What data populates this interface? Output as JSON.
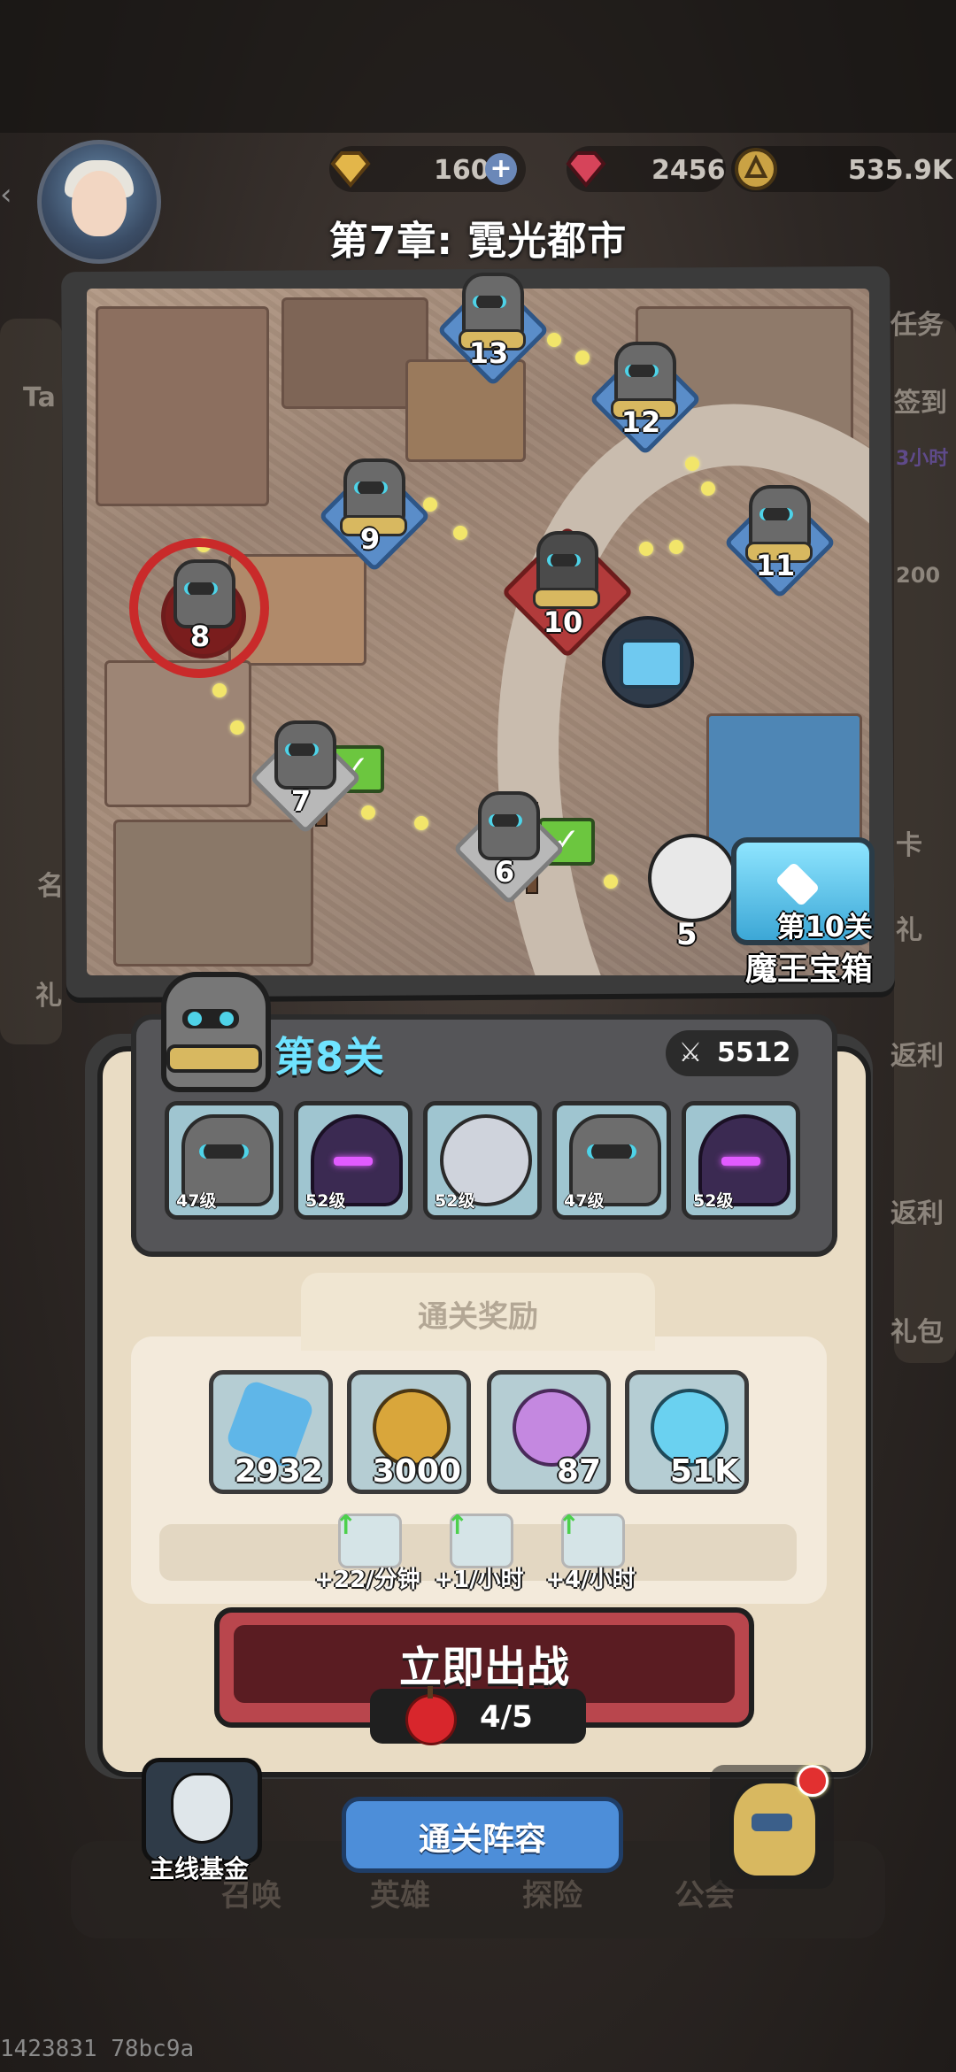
{
  "resources": {
    "gold_bars": "160",
    "gems": "2456",
    "coins": "535.9K"
  },
  "chapter": {
    "title": "第7章: 霓光都市"
  },
  "map": {
    "stages": [
      {
        "num": "13",
        "state": "locked"
      },
      {
        "num": "12",
        "state": "locked"
      },
      {
        "num": "9",
        "state": "locked"
      },
      {
        "num": "11",
        "state": "locked"
      },
      {
        "num": "10",
        "state": "boss"
      },
      {
        "num": "8",
        "state": "current"
      },
      {
        "num": "7",
        "state": "cleared"
      },
      {
        "num": "6",
        "state": "cleared"
      },
      {
        "num": "5",
        "state": "cleared"
      }
    ],
    "boss_chest": {
      "line1": "第10关",
      "line2": "魔王宝箱"
    },
    "check_mark": "✓"
  },
  "side_ghost_text": [
    "任务",
    "签到",
    "3小时",
    "200",
    "Ta",
    "名",
    "礼",
    "礼",
    "返利",
    "返利",
    "礼包",
    "卡"
  ],
  "stage_panel": {
    "stage_label": "第8关",
    "power": "5512",
    "enemies": [
      {
        "type": "robot",
        "level": "47级"
      },
      {
        "type": "mage",
        "level": "52级"
      },
      {
        "type": "pale",
        "level": "52级"
      },
      {
        "type": "robot",
        "level": "47级"
      },
      {
        "type": "mage",
        "level": "52级"
      }
    ],
    "reward_title": "通关奖励",
    "rewards": [
      {
        "item": "crystal",
        "qty": "2932",
        "color": "#5fb6e8"
      },
      {
        "item": "gold-coin",
        "qty": "3000",
        "color": "#d9a63b"
      },
      {
        "item": "purple-potion",
        "qty": "87",
        "color": "#c488e0"
      },
      {
        "item": "blue-potion",
        "qty": "51K",
        "color": "#6ad1f0"
      }
    ],
    "rates": [
      {
        "item": "blue-potion",
        "text": "+22/分钟"
      },
      {
        "item": "purple-potion",
        "text": "+1/小时"
      },
      {
        "item": "crystal",
        "text": "+4/小时"
      }
    ],
    "battle_button": "立即出战",
    "stamina": "4/5"
  },
  "bottom": {
    "fund_label": "主线基金",
    "lineup_button": "通关阵容",
    "nav_ghost": [
      "召唤",
      "英雄",
      "探险",
      "公会"
    ]
  },
  "build_id": "1423831 78bc9a",
  "colors": {
    "accent_cyan": "#6fe3ff",
    "battle_red": "#b9464d",
    "lineup_blue": "#4d8ed9",
    "panel_cream": "#e9dcc4"
  }
}
